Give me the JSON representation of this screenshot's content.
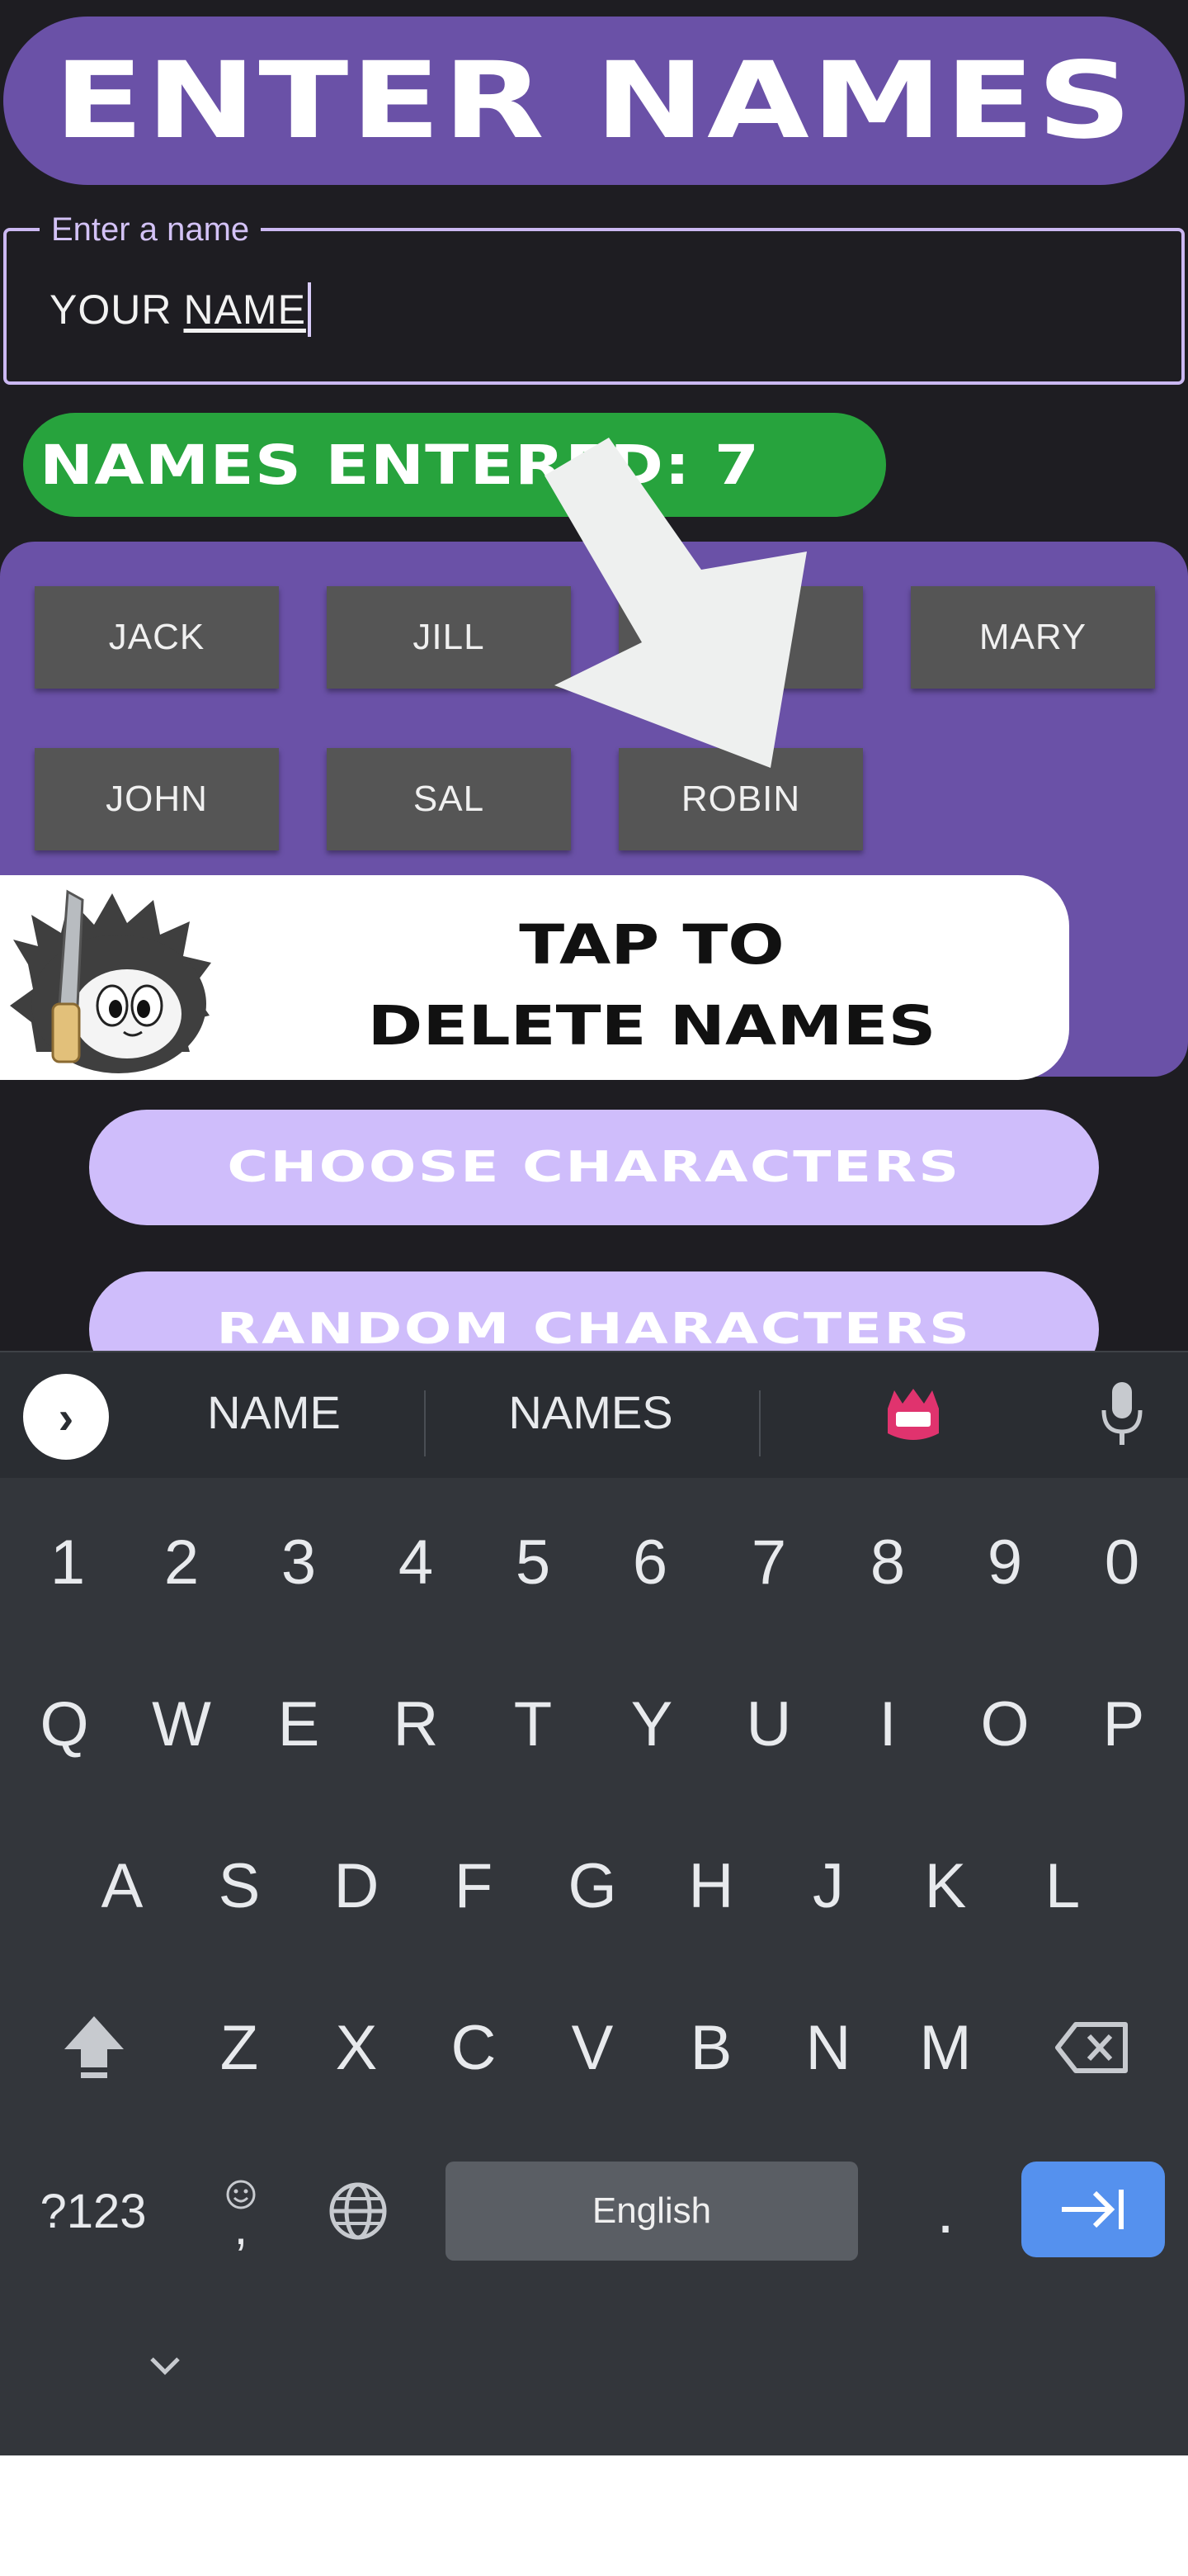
{
  "app": {
    "title": "ENTER NAMES",
    "input": {
      "label": "Enter a name",
      "value_word1": "YOUR",
      "value_word2": "NAME"
    },
    "names_entered_label": "NAMES ENTERED: 7",
    "names": [
      "JACK",
      "JILL",
      "",
      "MARY",
      "JOHN",
      "SAL",
      "ROBIN"
    ],
    "tap_hint_line1": "TAP TO",
    "tap_hint_line2": "DELETE NAMES",
    "choose_button": "CHOOSE CHARACTERS",
    "random_button": "RANDOM CHARACTERS"
  },
  "keyboard": {
    "suggestions": [
      "NAME",
      "NAMES"
    ],
    "suggestion_emoji_icon": "pink-monster-emoji-icon",
    "number_row": [
      "1",
      "2",
      "3",
      "4",
      "5",
      "6",
      "7",
      "8",
      "9",
      "0"
    ],
    "row1": [
      "Q",
      "W",
      "E",
      "R",
      "T",
      "Y",
      "U",
      "I",
      "O",
      "P"
    ],
    "row2": [
      "A",
      "S",
      "D",
      "F",
      "G",
      "H",
      "J",
      "K",
      "L"
    ],
    "row3": [
      "Z",
      "X",
      "C",
      "V",
      "B",
      "N",
      "M"
    ],
    "symbols_key": "?123",
    "comma_key": ",",
    "period_key": ".",
    "space_label": "English"
  },
  "colors": {
    "background": "#1e1d22",
    "purple": "#6a51a7",
    "green": "#27a33d",
    "lavender_button": "#cfbdfb",
    "chip": "#555555",
    "enter_key": "#5591ee"
  }
}
